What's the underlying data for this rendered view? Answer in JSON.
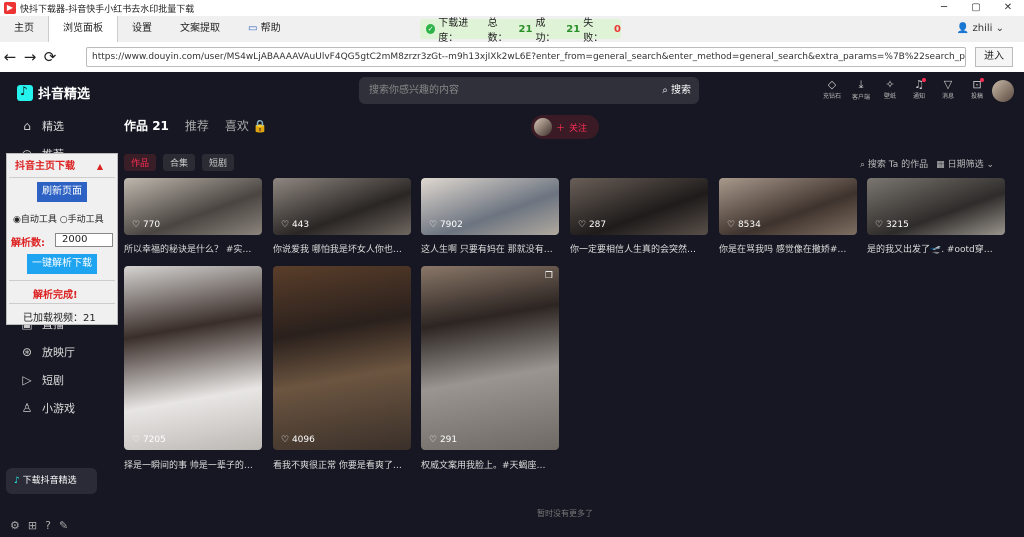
{
  "window": {
    "title": "快抖下载器-抖音快手小红书去水印批量下载"
  },
  "menu": {
    "tabs": [
      "主页",
      "浏览面板",
      "设置",
      "文案提取",
      "帮助"
    ]
  },
  "progress": {
    "label": "下载进度：",
    "total_label": "总数：",
    "total": "21",
    "success_label": "成功：",
    "success": "21",
    "fail_label": "失败：",
    "fail": "0"
  },
  "user": {
    "name": "zhili"
  },
  "address": {
    "url": "https://www.douyin.com/user/MS4wLjABAAAAVAuUlvF4QG5gtC2mM8zrzr3zGt--m9h13xjIXk2wL6E?enter_from=general_search&enter_method=general_search&extra_params=%7B%22search_params%22%",
    "go": "进入"
  },
  "brand": "抖音精选",
  "search": {
    "placeholder": "搜索你感兴趣的内容",
    "button": "搜索"
  },
  "header_icons": [
    {
      "icon": "diamond-icon",
      "label": "充钻石"
    },
    {
      "icon": "download-icon",
      "label": "客户端"
    },
    {
      "icon": "sparkle-icon",
      "label": "壁纸"
    },
    {
      "icon": "bell-icon",
      "label": "通知"
    },
    {
      "icon": "send-icon",
      "label": "消息"
    },
    {
      "icon": "upload-icon",
      "label": "投稿"
    }
  ],
  "sidebar": {
    "items": [
      {
        "label": "精选",
        "icon": "home-icon"
      },
      {
        "label": "推荐",
        "icon": "recommend-icon"
      },
      {
        "label": "直播",
        "icon": "live-icon"
      },
      {
        "label": "放映厅",
        "icon": "theater-icon"
      },
      {
        "label": "短剧",
        "icon": "drama-icon"
      },
      {
        "label": "小游戏",
        "icon": "game-icon"
      }
    ],
    "download_btn": "下载抖音精选"
  },
  "panel": {
    "title": "抖音主页下载",
    "refresh": "刷新页面",
    "radio_auto": "自动工具",
    "radio_manual": "手动工具",
    "count_label": "解析数:",
    "count": "2000",
    "parse_btn": "一键解析下载",
    "done": "解析完成!",
    "loaded": "已加载视频：21"
  },
  "profile": {
    "tab_works": "作品",
    "works_count": "21",
    "tab_rec": "推荐",
    "tab_like": "喜欢",
    "follow": "关注"
  },
  "subtabs": [
    "作品",
    "合集",
    "短剧"
  ],
  "filter": {
    "search": "搜索 Ta 的作品",
    "date": "日期筛选"
  },
  "videos": [
    {
      "likes": "770",
      "caption": "所以幸福的秘诀是什么？ #实…"
    },
    {
      "likes": "443",
      "caption": "你说爱我 哪怕我是坏女人你也…"
    },
    {
      "likes": "7902",
      "caption": "这人生啊 只要有妈在 那就没有…"
    },
    {
      "likes": "287",
      "caption": "你一定要相信人生真的会突然…"
    },
    {
      "likes": "8534",
      "caption": "你是在骂我吗 感觉像在撒娇#…"
    },
    {
      "likes": "3215",
      "caption": "是的我又出发了🛫. #ootd穿…"
    },
    {
      "likes": "7205",
      "caption": "择是一瞬间的事 帅是一辈子的…"
    },
    {
      "likes": "4096",
      "caption": "看我不爽很正常 你要是看爽了…"
    },
    {
      "likes": "291",
      "caption": "权威文案用我脸上。#天蝎座…"
    }
  ],
  "footer": "暂时没有更多了"
}
